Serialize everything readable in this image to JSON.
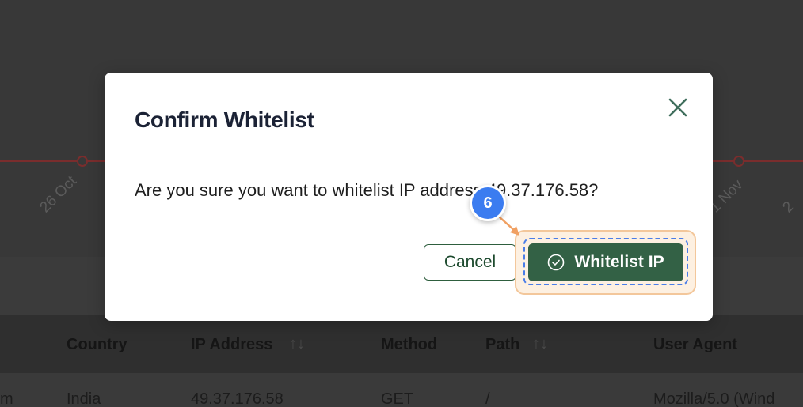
{
  "background": {
    "chart_ticks": [
      "26 Oct",
      "1 Nov",
      "2"
    ],
    "table": {
      "headers": [
        "Country",
        "IP Address",
        "Method",
        "Path",
        "User Agent"
      ],
      "row": {
        "col0": "m",
        "country": "India",
        "ip": "49.37.176.58",
        "method": "GET",
        "path": "/",
        "user_agent": "Mozilla/5.0 (Wind"
      },
      "sort_glyph": "↑↓"
    }
  },
  "modal": {
    "title": "Confirm Whitelist",
    "message": "Are you sure you want to whitelist IP address 49.37.176.58?",
    "cancel_label": "Cancel",
    "confirm_label": "Whitelist IP",
    "close_icon": "close-icon",
    "confirm_icon": "check-circle-icon"
  },
  "annotation": {
    "step_number": "6"
  },
  "colors": {
    "primary_green": "#336145",
    "step_blue": "#3b7cf0",
    "highlight_orange": "#f3c79b"
  }
}
